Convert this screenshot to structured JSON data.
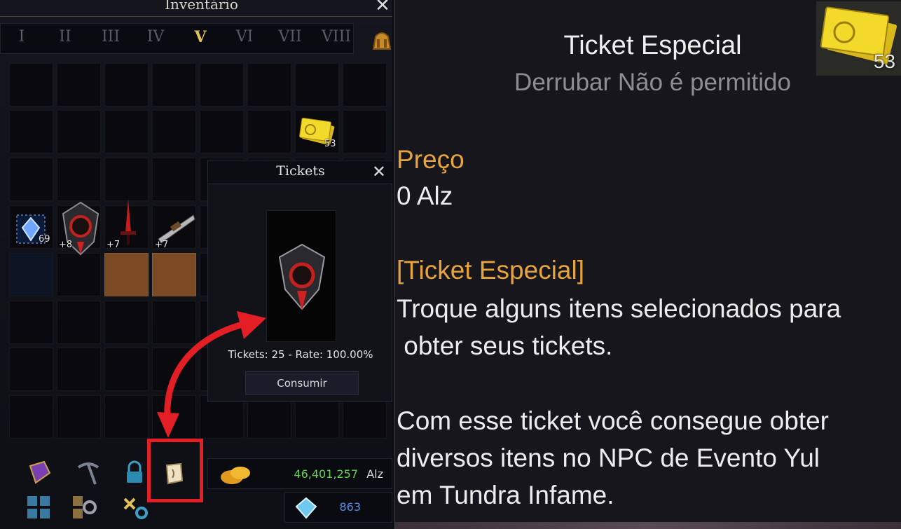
{
  "inventory": {
    "title": "Inventário",
    "close": "✕",
    "tabs": [
      "I",
      "II",
      "III",
      "IV",
      "V",
      "VI",
      "VII",
      "VIII"
    ],
    "active_tab": "V",
    "items": {
      "ticket_qty": "53",
      "crystal_qty": "69",
      "armor_qty": "+8",
      "sword_qty": "+7",
      "weapon_qty": "+7"
    }
  },
  "tickets_popup": {
    "title": "Tickets",
    "close": "✕",
    "info": "Tickets: 25 - Rate: 100.00%",
    "consume_label": "Consumir"
  },
  "currency": {
    "alz_value": "46,401,257",
    "alz_unit": "Alz",
    "gem_value": "863"
  },
  "tooltip": {
    "name": "Ticket Especial",
    "restriction": "Derrubar Não é permitido",
    "icon_qty": "53",
    "price_label": "Preço",
    "price_value": "0 Alz",
    "section_title": "[Ticket Especial]",
    "desc_line1": "Troque alguns itens selecionados para",
    "desc_line2": " obter seus tickets.",
    "desc2_line1": "Com esse ticket você consegue obter",
    "desc2_line2": "diversos itens no NPC de Evento Yul",
    "desc2_line3": "em Tundra Infame."
  },
  "colors": {
    "accent_gold": "#e7a33c",
    "alz_green": "#5fd44a",
    "gem_blue": "#5b8ee0",
    "highlight_red": "#e31e24"
  },
  "icons": [
    "bag-icon",
    "ticket-icon",
    "crystal-icon",
    "armor-icon",
    "sword-icon",
    "weapon-icon",
    "cube-icon",
    "pickaxe-icon",
    "lock-icon",
    "scroll-icon",
    "grid-icon",
    "gear-grid-icon",
    "key-gear-icon",
    "gold-coins-icon",
    "diamond-icon"
  ]
}
